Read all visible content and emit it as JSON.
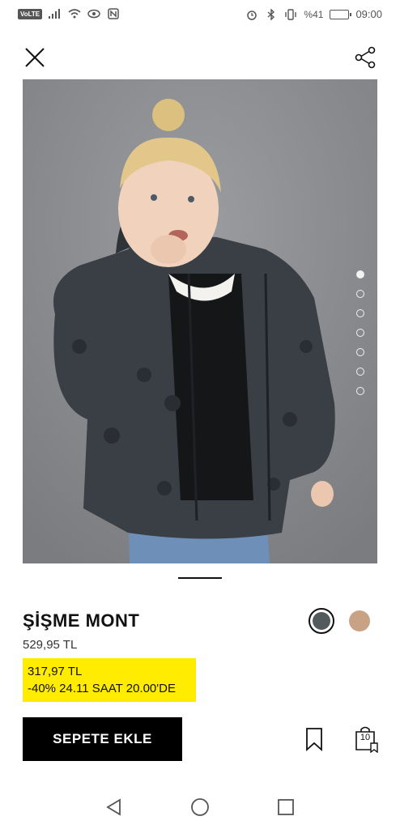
{
  "status_bar": {
    "volte": "VoLTE",
    "battery_text": "%41",
    "time": "09:00"
  },
  "product": {
    "name": "ŞİŞME MONT",
    "original_price": "529,95 TL",
    "sale_price": "317,97 TL",
    "promo_text": "-40% 24.11 SAAT 20.00'DE"
  },
  "colors": {
    "promo_bg": "#ffec00",
    "swatch_selected": "#525a5c",
    "swatch_alt": "#c9a286",
    "button_bg": "#000000"
  },
  "gallery": {
    "image_count": 7,
    "active_index": 0
  },
  "actions": {
    "add_to_cart_label": "SEPETE EKLE",
    "bag_count": "10"
  },
  "icons": {
    "close": "close-icon",
    "share": "share-icon",
    "bookmark": "bookmark-icon",
    "bag": "shopping-bag-icon",
    "back": "back-icon",
    "home": "home-icon",
    "recents": "recents-icon"
  }
}
